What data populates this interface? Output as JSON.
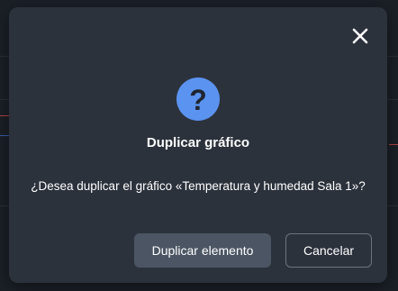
{
  "dialog": {
    "title": "Duplicar gráfico",
    "message": "¿Desea duplicar el gráfico «Temperatura y humedad Sala 1»?",
    "icon": "question-icon",
    "icon_glyph": "?",
    "close_icon": "close-icon",
    "primary_button_label": "Duplicar elemento",
    "secondary_button_label": "Cancelar"
  },
  "colors": {
    "dialog_background": "#2c323c",
    "accent": "#5b93f0",
    "primary_button": "#4b5563",
    "text": "#ffffff"
  }
}
